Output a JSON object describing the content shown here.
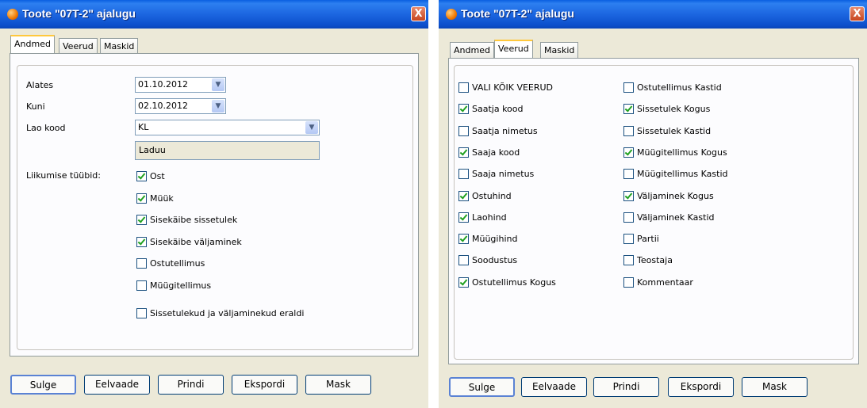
{
  "dialog1": {
    "title": "Toote \"07T-2\" ajalugu",
    "close": "X",
    "tabs": [
      "Andmed",
      "Veerud",
      "Maskid"
    ],
    "active_tab": "Andmed",
    "fields": {
      "alates_label": "Alates",
      "alates_value": "01.10.2012",
      "kuni_label": "Kuni",
      "kuni_value": "02.10.2012",
      "lao_kood_label": "Lao kood",
      "lao_kood_value": "KL",
      "lao_nimi_value": "Laduu",
      "liikumise_label": "Liikumise tüübid:"
    },
    "movement_types": [
      {
        "label": "Ost",
        "checked": true
      },
      {
        "label": "Müük",
        "checked": true
      },
      {
        "label": "Sisekäibe sissetulek",
        "checked": true
      },
      {
        "label": "Sisekäibe väljaminek",
        "checked": true
      },
      {
        "label": "Ostutellimus",
        "checked": false
      },
      {
        "label": "Müügitellimus",
        "checked": false
      }
    ],
    "separate": {
      "label": "Sissetulekud ja väljaminekud eraldi",
      "checked": false
    },
    "buttons": [
      "Sulge",
      "Eelvaade",
      "Prindi",
      "Ekspordi",
      "Mask"
    ]
  },
  "dialog2": {
    "title": "Toote \"07T-2\" ajalugu",
    "close": "X",
    "tabs": [
      "Andmed",
      "Veerud",
      "Maskid"
    ],
    "active_tab": "Veerud",
    "columns_left": [
      {
        "label": "VALI KÕIK VEERUD",
        "checked": false
      },
      {
        "label": "Saatja kood",
        "checked": true
      },
      {
        "label": "Saatja nimetus",
        "checked": false
      },
      {
        "label": "Saaja kood",
        "checked": true
      },
      {
        "label": "Saaja nimetus",
        "checked": false
      },
      {
        "label": "Ostuhind",
        "checked": true
      },
      {
        "label": "Laohind",
        "checked": true
      },
      {
        "label": "Müügihind",
        "checked": true
      },
      {
        "label": "Soodustus",
        "checked": false
      },
      {
        "label": "Ostutellimus Kogus",
        "checked": true
      }
    ],
    "columns_right": [
      {
        "label": "Ostutellimus Kastid",
        "checked": false
      },
      {
        "label": "Sissetulek Kogus",
        "checked": true
      },
      {
        "label": "Sissetulek Kastid",
        "checked": false
      },
      {
        "label": "Müügitellimus Kogus",
        "checked": true
      },
      {
        "label": "Müügitellimus Kastid",
        "checked": false
      },
      {
        "label": "Väljaminek Kogus",
        "checked": true
      },
      {
        "label": "Väljaminek Kastid",
        "checked": false
      },
      {
        "label": "Partii",
        "checked": false
      },
      {
        "label": "Teostaja",
        "checked": false
      },
      {
        "label": "Kommentaar",
        "checked": false
      }
    ],
    "buttons": [
      "Sulge",
      "Eelvaade",
      "Prindi",
      "Ekspordi",
      "Mask"
    ]
  }
}
